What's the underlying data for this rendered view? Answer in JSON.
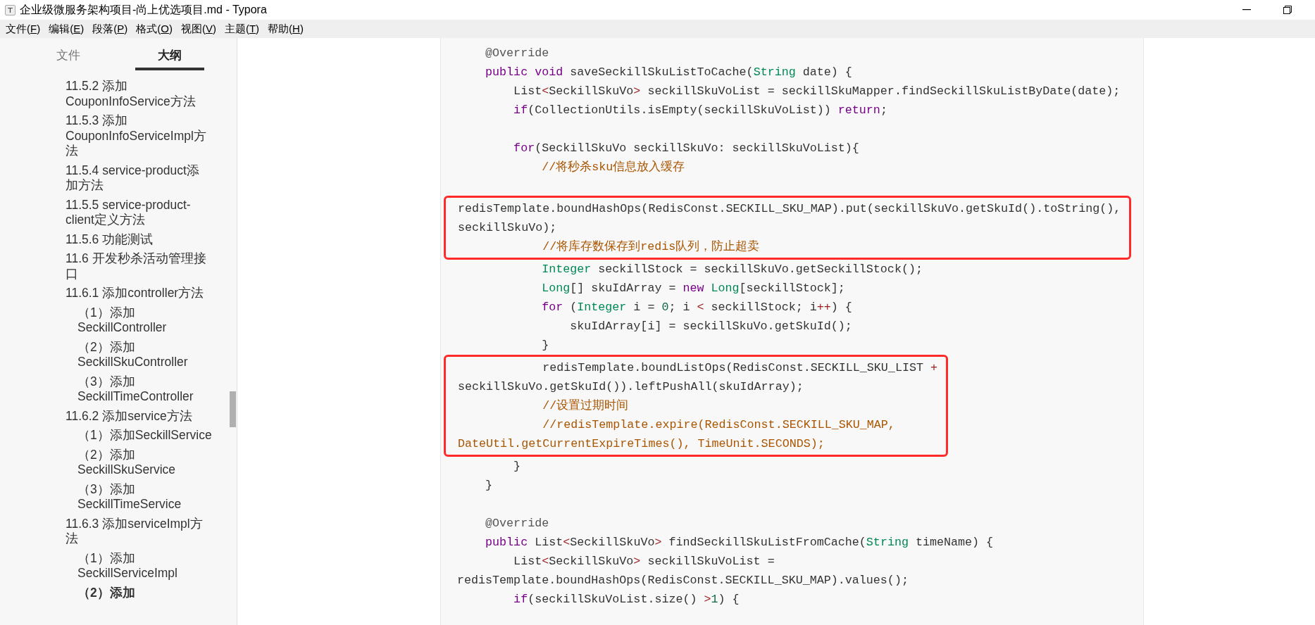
{
  "window": {
    "title": "企业级微服务架构项目-尚上优选项目.md - Typora"
  },
  "menu": [
    "文件(F)",
    "编辑(E)",
    "段落(P)",
    "格式(O)",
    "视图(V)",
    "主题(T)",
    "帮助(H)"
  ],
  "sidebar": {
    "tabs": [
      {
        "label": "文件",
        "selected": false
      },
      {
        "label": "大纲",
        "selected": true
      }
    ],
    "outline": [
      {
        "label": "11.5.2 添加CouponInfoService方法",
        "selected": false
      },
      {
        "label": "11.5.3 添加CouponInfoServiceImpl方法",
        "selected": false
      },
      {
        "label": "11.5.4 service-product添加方法",
        "selected": false
      },
      {
        "label": "11.5.5 service-product-client定义方法",
        "selected": false
      },
      {
        "label": "11.5.6 功能测试",
        "selected": false
      },
      {
        "label": "11.6 开发秒杀活动管理接口",
        "selected": false
      },
      {
        "label": "11.6.1 添加controller方法",
        "selected": false,
        "children": [
          {
            "label": "（1）添加SeckillController",
            "selected": false
          },
          {
            "label": "（2）添加SeckillSkuController",
            "selected": false
          },
          {
            "label": "（3）添加SeckillTimeController",
            "selected": false
          }
        ]
      },
      {
        "label": "11.6.2 添加service方法",
        "selected": false,
        "children": [
          {
            "label": "（1）添加SeckillService",
            "selected": false
          },
          {
            "label": "（2）添加SeckillSkuService",
            "selected": false
          },
          {
            "label": "（3）添加SeckillTimeService",
            "selected": false
          }
        ]
      },
      {
        "label": "11.6.3 添加serviceImpl方法",
        "selected": false,
        "children": [
          {
            "label": "（1）添加SeckillServiceImpl",
            "selected": false
          },
          {
            "label": "（2）添加",
            "selected": true
          }
        ]
      }
    ]
  },
  "code": {
    "blocks": [
      {
        "highlighted": false,
        "lines": [
          {
            "kind": "code",
            "tokens": [
              {
                "kind": "annotation",
                "text": "    @Override"
              }
            ]
          },
          {
            "kind": "code",
            "tokens": [
              {
                "kind": "keyword",
                "text": "    public"
              },
              {
                "kind": "keyword",
                "text": " void"
              },
              {
                "kind": "plain",
                "text": " saveSeckillSkuListToCache("
              },
              {
                "kind": "type",
                "text": "String"
              },
              {
                "kind": "plain",
                "text": " date) {"
              }
            ]
          },
          {
            "kind": "code",
            "tokens": [
              {
                "kind": "plain",
                "text": "        List"
              },
              {
                "kind": "operator",
                "text": "<"
              },
              {
                "kind": "plain",
                "text": "SeckillSkuVo"
              },
              {
                "kind": "operator",
                "text": ">"
              },
              {
                "kind": "plain",
                "text": " seckillSkuVoList = seckillSkuMapper.findSeckillSkuListByDate(date);"
              }
            ]
          },
          {
            "kind": "code",
            "tokens": [
              {
                "kind": "keyword",
                "text": "        if"
              },
              {
                "kind": "plain",
                "text": "(CollectionUtils.isEmpty(seckillSkuVoList)) "
              },
              {
                "kind": "keyword",
                "text": "return"
              },
              {
                "kind": "plain",
                "text": ";"
              }
            ]
          },
          {
            "kind": "blank"
          },
          {
            "kind": "code",
            "tokens": [
              {
                "kind": "keyword",
                "text": "        for"
              },
              {
                "kind": "plain",
                "text": "(SeckillSkuVo seckillSkuVo: seckillSkuVoList){"
              }
            ]
          },
          {
            "kind": "code",
            "tokens": [
              {
                "kind": "comment",
                "text": "            //将秒杀sku信息放入缓存"
              }
            ]
          },
          {
            "kind": "blank"
          }
        ]
      },
      {
        "highlighted": true,
        "lines": [
          {
            "kind": "code",
            "tokens": [
              {
                "kind": "plain",
                "text": "redisTemplate.boundHashOps(RedisConst.SECKILL_SKU_MAP).put(seckillSkuVo.getSkuId().toString(),"
              }
            ]
          },
          {
            "kind": "code",
            "tokens": [
              {
                "kind": "plain",
                "text": "seckillSkuVo);"
              }
            ]
          },
          {
            "kind": "code",
            "tokens": [
              {
                "kind": "comment",
                "text": "            //将库存数保存到redis队列，防止超卖"
              }
            ]
          }
        ]
      },
      {
        "highlighted": false,
        "lines": [
          {
            "kind": "code",
            "tokens": [
              {
                "kind": "type",
                "text": "            Integer"
              },
              {
                "kind": "plain",
                "text": " seckillStock = seckillSkuVo.getSeckillStock();"
              }
            ]
          },
          {
            "kind": "code",
            "tokens": [
              {
                "kind": "type",
                "text": "            Long"
              },
              {
                "kind": "plain",
                "text": "[] skuIdArray = "
              },
              {
                "kind": "keyword",
                "text": "new"
              },
              {
                "kind": "type",
                "text": " Long"
              },
              {
                "kind": "plain",
                "text": "[seckillStock];"
              }
            ]
          },
          {
            "kind": "code",
            "tokens": [
              {
                "kind": "keyword",
                "text": "            for"
              },
              {
                "kind": "plain",
                "text": " ("
              },
              {
                "kind": "type",
                "text": "Integer"
              },
              {
                "kind": "plain",
                "text": " i = "
              },
              {
                "kind": "number",
                "text": "0"
              },
              {
                "kind": "plain",
                "text": "; i "
              },
              {
                "kind": "operator",
                "text": "<"
              },
              {
                "kind": "plain",
                "text": " seckillStock; i"
              },
              {
                "kind": "operator",
                "text": "++"
              },
              {
                "kind": "plain",
                "text": ") {"
              }
            ]
          },
          {
            "kind": "code",
            "tokens": [
              {
                "kind": "plain",
                "text": "                skuIdArray[i] = seckillSkuVo.getSkuId();"
              }
            ]
          },
          {
            "kind": "code",
            "tokens": [
              {
                "kind": "plain",
                "text": "            }"
              }
            ]
          }
        ]
      },
      {
        "highlighted": true,
        "lines": [
          {
            "kind": "code",
            "tokens": [
              {
                "kind": "plain",
                "text": "            redisTemplate.boundListOps(RedisConst.SECKILL_SKU_LIST "
              },
              {
                "kind": "operator",
                "text": "+"
              }
            ]
          },
          {
            "kind": "code",
            "tokens": [
              {
                "kind": "plain",
                "text": "seckillSkuVo.getSkuId()).leftPushAll(skuIdArray);"
              }
            ]
          },
          {
            "kind": "code",
            "tokens": [
              {
                "kind": "comment",
                "text": "            //设置过期时间"
              }
            ]
          },
          {
            "kind": "code",
            "tokens": [
              {
                "kind": "comment",
                "text": "            //redisTemplate.expire(RedisConst.SECKILL_SKU_MAP,"
              }
            ]
          },
          {
            "kind": "code",
            "tokens": [
              {
                "kind": "comment",
                "text": "DateUtil.getCurrentExpireTimes(), TimeUnit.SECONDS);"
              }
            ]
          }
        ]
      },
      {
        "highlighted": false,
        "lines": [
          {
            "kind": "code",
            "tokens": [
              {
                "kind": "plain",
                "text": "        }"
              }
            ]
          },
          {
            "kind": "code",
            "tokens": [
              {
                "kind": "plain",
                "text": "    }"
              }
            ]
          },
          {
            "kind": "blank"
          },
          {
            "kind": "code",
            "tokens": [
              {
                "kind": "annotation",
                "text": "    @Override"
              }
            ]
          },
          {
            "kind": "code",
            "tokens": [
              {
                "kind": "keyword",
                "text": "    public"
              },
              {
                "kind": "plain",
                "text": " List"
              },
              {
                "kind": "operator",
                "text": "<"
              },
              {
                "kind": "plain",
                "text": "SeckillSkuVo"
              },
              {
                "kind": "operator",
                "text": ">"
              },
              {
                "kind": "plain",
                "text": " findSeckillSkuListFromCache("
              },
              {
                "kind": "type",
                "text": "String"
              },
              {
                "kind": "plain",
                "text": " timeName) {"
              }
            ]
          },
          {
            "kind": "code",
            "tokens": [
              {
                "kind": "plain",
                "text": "        List"
              },
              {
                "kind": "operator",
                "text": "<"
              },
              {
                "kind": "plain",
                "text": "SeckillSkuVo"
              },
              {
                "kind": "operator",
                "text": ">"
              },
              {
                "kind": "plain",
                "text": " seckillSkuVoList ="
              }
            ]
          },
          {
            "kind": "code",
            "tokens": [
              {
                "kind": "plain",
                "text": "redisTemplate.boundHashOps(RedisConst.SECKILL_SKU_MAP).values();"
              }
            ]
          },
          {
            "kind": "code",
            "tokens": [
              {
                "kind": "keyword",
                "text": "        if"
              },
              {
                "kind": "plain",
                "text": "(seckillSkuVoList.size() "
              },
              {
                "kind": "operator",
                "text": ">"
              },
              {
                "kind": "number",
                "text": "1"
              },
              {
                "kind": "plain",
                "text": ") {"
              }
            ]
          }
        ]
      }
    ]
  }
}
